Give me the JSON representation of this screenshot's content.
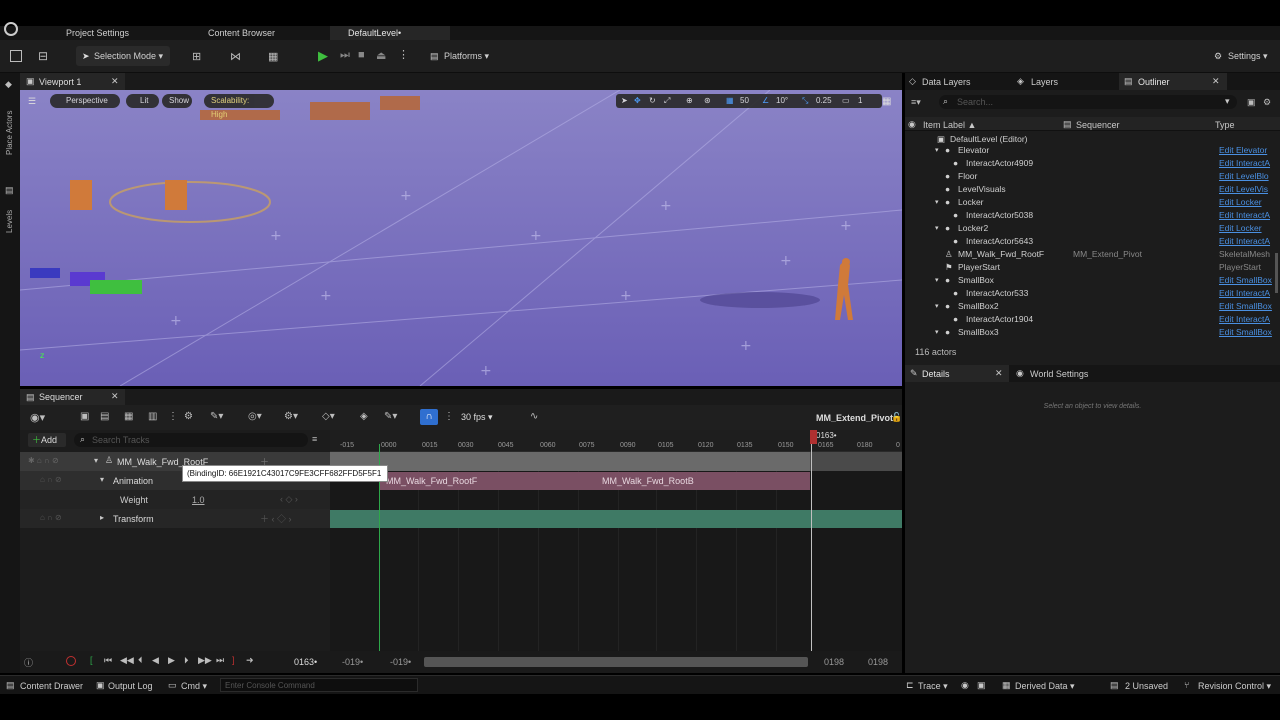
{
  "tabs": [
    {
      "label": "Project Settings"
    },
    {
      "label": "Content Browser"
    },
    {
      "label": "DefaultLevel•"
    }
  ],
  "toolbar": {
    "selection_mode": "Selection Mode",
    "platforms": "Platforms",
    "settings": "Settings"
  },
  "left_strip": {
    "place_actors": "Place Actors",
    "levels": "Levels"
  },
  "viewport": {
    "tab_label": "Viewport 1",
    "perspective": "Perspective",
    "lit": "Lit",
    "show": "Show",
    "scalability": "Scalability: High",
    "grid_size": "50",
    "rotation_snap": "10°",
    "scale_snap": "0.25",
    "camera_speed": "1"
  },
  "sequencer": {
    "tab_label": "Sequencer",
    "fps": "30 fps",
    "sequence_name": "MM_Extend_Pivot",
    "add_label": "Add",
    "search_placeholder": "Search Tracks",
    "tracks": [
      {
        "label": "MM_Walk_Fwd_RootF"
      },
      {
        "label": "Animation"
      },
      {
        "label": "Weight",
        "value": "1.0"
      },
      {
        "label": "Transform"
      }
    ],
    "tooltip": "(BindingID: 66E1921C43017C9FE3CFF682FFD5F5F1",
    "ticks": [
      "-015",
      "0000",
      "0015",
      "0030",
      "0045",
      "0060",
      "0075",
      "0090",
      "0105",
      "0120",
      "0135",
      "0150",
      "0165",
      "0180",
      "0"
    ],
    "playhead": "0163•",
    "section_a": "MM_Walk_Fwd_RootF",
    "section_b": "MM_Walk_Fwd_RootB",
    "transport": {
      "current": "0163•",
      "start_a": "-019•",
      "start_b": "-019•",
      "end_a": "0198",
      "end_b": "0198"
    }
  },
  "outliner": {
    "tabs": [
      {
        "label": "Data Layers"
      },
      {
        "label": "Layers"
      },
      {
        "label": "Outliner"
      }
    ],
    "search_placeholder": "Search...",
    "columns": {
      "label": "Item Label ▲",
      "sequencer": "Sequencer",
      "type": "Type"
    },
    "rows": [
      {
        "label": "DefaultLevel (Editor)",
        "seq": "",
        "type": ""
      },
      {
        "label": "Elevator",
        "seq": "",
        "type": "Edit Elevator"
      },
      {
        "label": "InteractActor4909",
        "seq": "",
        "type": "Edit InteractA"
      },
      {
        "label": "Floor",
        "seq": "",
        "type": "Edit LevelBlo"
      },
      {
        "label": "LevelVisuals",
        "seq": "",
        "type": "Edit LevelVis"
      },
      {
        "label": "Locker",
        "seq": "",
        "type": "Edit Locker"
      },
      {
        "label": "InteractActor5038",
        "seq": "",
        "type": "Edit InteractA"
      },
      {
        "label": "Locker2",
        "seq": "",
        "type": "Edit Locker"
      },
      {
        "label": "InteractActor5643",
        "seq": "",
        "type": "Edit InteractA"
      },
      {
        "label": "MM_Walk_Fwd_RootF",
        "seq": "MM_Extend_Pivot",
        "type": "SkeletalMesh"
      },
      {
        "label": "PlayerStart",
        "seq": "",
        "type": "PlayerStart"
      },
      {
        "label": "SmallBox",
        "seq": "",
        "type": "Edit SmallBox"
      },
      {
        "label": "InteractActor533",
        "seq": "",
        "type": "Edit InteractA"
      },
      {
        "label": "SmallBox2",
        "seq": "",
        "type": "Edit SmallBox"
      },
      {
        "label": "InteractActor1904",
        "seq": "",
        "type": "Edit InteractA"
      },
      {
        "label": "SmallBox3",
        "seq": "",
        "type": "Edit SmallBox"
      }
    ],
    "actor_count": "116 actors"
  },
  "details": {
    "tab_label": "Details",
    "world_settings": "World Settings",
    "empty_text": "Select an object to view details."
  },
  "statusbar": {
    "content_drawer": "Content Drawer",
    "output_log": "Output Log",
    "cmd": "Cmd",
    "console_placeholder": "Enter Console Command",
    "trace": "Trace",
    "derived_data": "Derived Data",
    "unsaved": "2 Unsaved",
    "revision_control": "Revision Control"
  }
}
